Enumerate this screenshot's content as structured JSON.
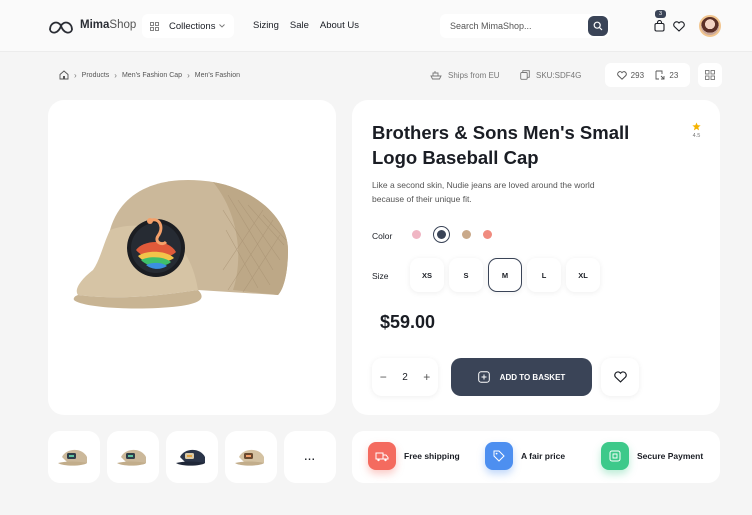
{
  "header": {
    "logo_brand": "Mima",
    "logo_suffix": "Shop",
    "collections_label": "Collections",
    "nav": [
      "Sizing",
      "Sale",
      "About Us"
    ],
    "search_placeholder": "Search MimaShop...",
    "cart_count": "3"
  },
  "breadcrumb": [
    "Products",
    "Men's Fashion Cap",
    "Men's Fashion"
  ],
  "meta": {
    "shipping": "Ships from EU",
    "sku": "SKU:SDF4G",
    "likes": "293",
    "shares": "23"
  },
  "product": {
    "title": "Brothers & Sons Men's Small Logo Baseball Cap",
    "rating": "4.5",
    "description": "Like a second skin, Nudie jeans are loved around the world because of their unique fit.",
    "color_label": "Color",
    "colors": [
      "#f0b6c4",
      "#3a4457",
      "#c9a98a",
      "#f08b7f"
    ],
    "selected_color": "#3a4457",
    "size_label": "Size",
    "sizes": [
      "XS",
      "S",
      "M",
      "L",
      "XL"
    ],
    "selected_size": "M",
    "price": "$59.00",
    "quantity": "2",
    "add_to_basket": "ADD TO BASKET"
  },
  "thumbnails": {
    "more_label": "..."
  },
  "features": [
    {
      "label": "Free shipping",
      "icon": "truck-icon",
      "color": "#f46b5f"
    },
    {
      "label": "A fair price",
      "icon": "tag-icon",
      "color": "#4d8ff0"
    },
    {
      "label": "Secure Payment",
      "icon": "card-icon",
      "color": "#3dc98a"
    }
  ],
  "accent_color": "#3a4457"
}
